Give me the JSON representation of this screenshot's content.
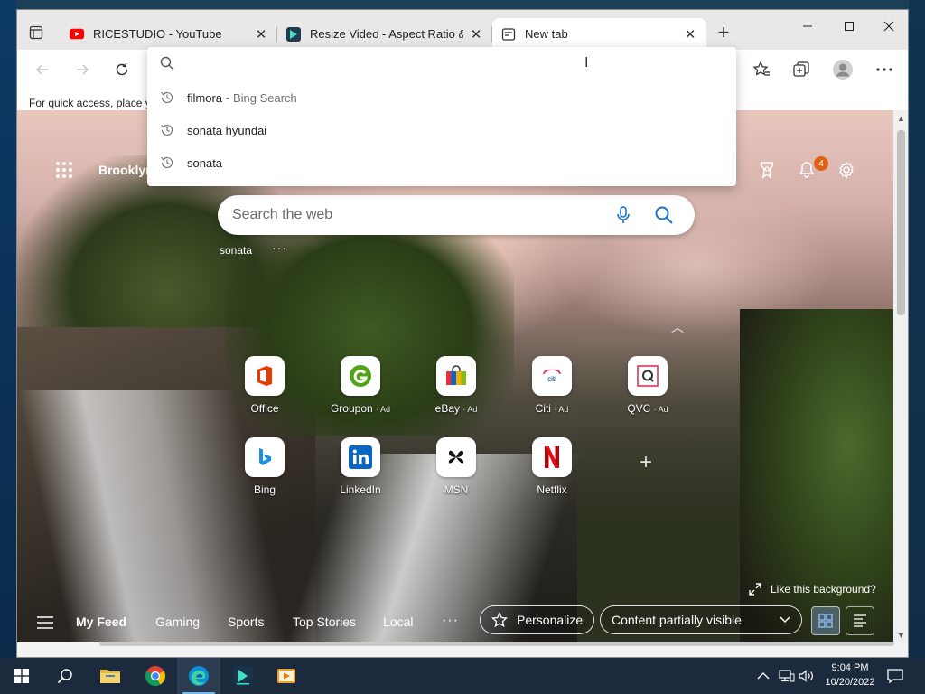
{
  "tabs": [
    {
      "title": "RICESTUDIO - YouTube",
      "favicon": "youtube-icon"
    },
    {
      "title": "Resize Video - Aspect Ratio & D",
      "favicon": "filmora-icon"
    },
    {
      "title": "New tab",
      "favicon": "newtab-page-icon"
    }
  ],
  "toolbar": {
    "favorites_hint": "For quick access, place y"
  },
  "omnibox": {
    "suggestions": [
      {
        "query": "filmora",
        "source": "- Bing Search"
      },
      {
        "query": "sonata hyundai",
        "source": ""
      },
      {
        "query": "sonata",
        "source": ""
      }
    ]
  },
  "header": {
    "location": "Brooklyn",
    "notification_count": "4"
  },
  "search": {
    "placeholder": "Search the web",
    "recent_chip": "sonata"
  },
  "quick_links": [
    {
      "label": "Office",
      "ad": ""
    },
    {
      "label": "Groupon",
      "ad": "· Ad"
    },
    {
      "label": "eBay",
      "ad": "· Ad"
    },
    {
      "label": "Citi",
      "ad": "· Ad"
    },
    {
      "label": "QVC",
      "ad": "· Ad"
    },
    {
      "label": "Bing",
      "ad": ""
    },
    {
      "label": "LinkedIn",
      "ad": ""
    },
    {
      "label": "MSN",
      "ad": ""
    },
    {
      "label": "Netflix",
      "ad": ""
    }
  ],
  "background": {
    "like_text": "Like this background?"
  },
  "feed": {
    "tabs": [
      "My Feed",
      "Gaming",
      "Sports",
      "Top Stories",
      "Local"
    ],
    "personalize": "Personalize",
    "visibility": "Content partially visible"
  },
  "taskbar": {
    "time": "9:04 PM",
    "date": "10/20/2022"
  },
  "colors": {
    "edge_accent": "#0078d4",
    "notification_badge": "#e05f16",
    "youtube_red": "#ff0000",
    "netflix_red": "#e50914",
    "taskbar": "#1b2a3c"
  }
}
